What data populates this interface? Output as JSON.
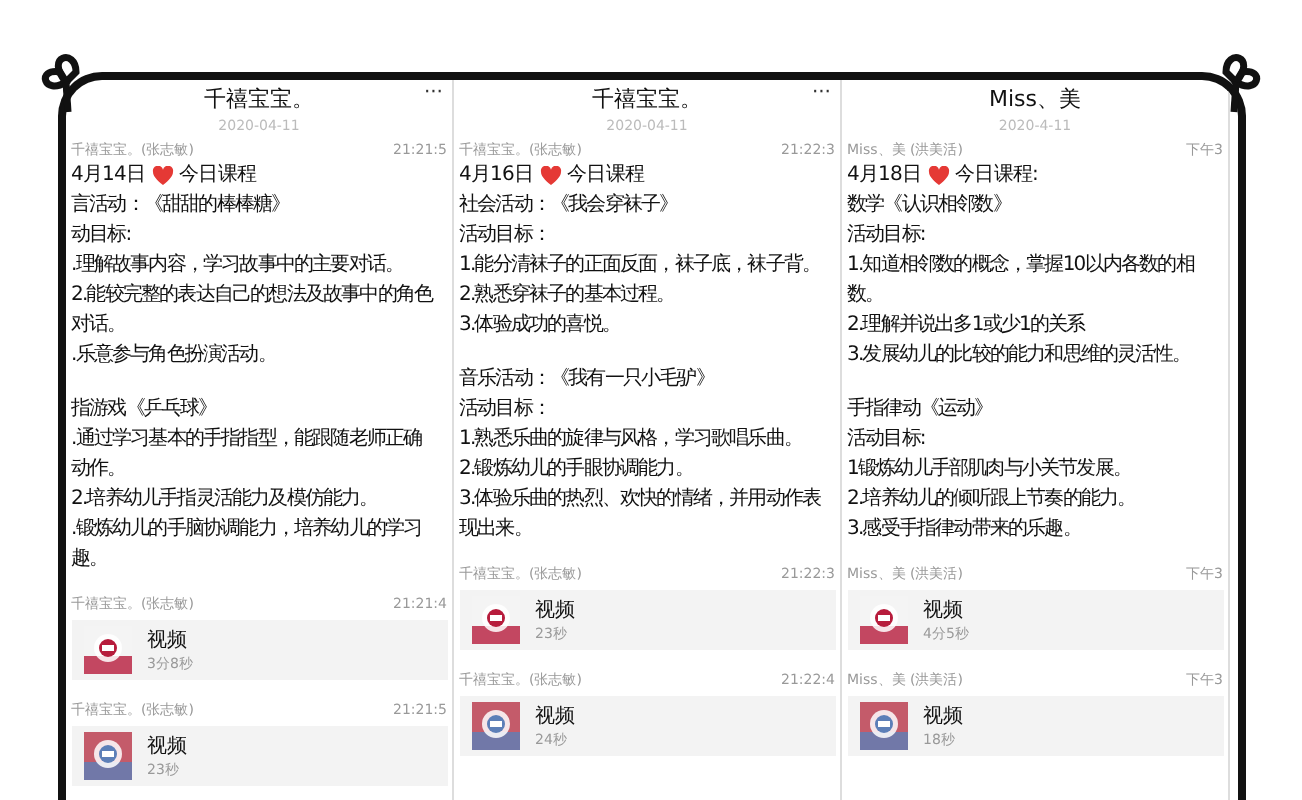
{
  "panels": [
    {
      "title": "千禧宝宝。",
      "menu": "···",
      "date": "2020-04-11",
      "messages": [
        {
          "kind": "text",
          "sender": "千禧宝宝。(张志敏)",
          "time": "21:21:5",
          "heading": {
            "day": "4月14日",
            "title": "今日课程"
          },
          "paragraphs": [
            [
              "言活动：《甜甜的棒棒糖》",
              "动目标:",
              ".理解故事内容，学习故事中的主要对话。",
              "2.能较完整的表达自己的想法及故事中的角色",
              "对话。",
              ".乐意参与角色扮演活动。"
            ],
            [
              "指游戏《乒乓球》",
              ".通过学习基本的手指指型，能跟随老师正确",
              "动作。",
              "2.培养幼儿手指灵活能力及模仿能力。",
              ".锻炼幼儿的手脑协调能力，培养幼儿的学习",
              "趣。"
            ]
          ]
        },
        {
          "kind": "video",
          "sender": "千禧宝宝。(张志敏)",
          "time": "21:21:4",
          "label": "视频",
          "duration": "3分8秒"
        },
        {
          "kind": "video",
          "sender": "千禧宝宝。(张志敏)",
          "time": "21:21:5",
          "label": "视频",
          "duration": "23秒"
        }
      ]
    },
    {
      "title": "千禧宝宝。",
      "menu": "···",
      "date": "2020-04-11",
      "messages": [
        {
          "kind": "text",
          "sender": "千禧宝宝。(张志敏)",
          "time": "21:22:3",
          "heading": {
            "day": "4月16日",
            "title": "今日课程"
          },
          "paragraphs": [
            [
              "社会活动：《我会穿袜子》",
              "活动目标：",
              "1.能分清袜子的正面反面，袜子底，袜子背。",
              "2.熟悉穿袜子的基本过程。",
              "3.体验成功的喜悦。"
            ],
            [
              "音乐活动：《我有一只小毛驴》",
              "活动目标：",
              "1.熟悉乐曲的旋律与风格，学习歌唱乐曲。",
              "2.锻炼幼儿的手眼协调能力。",
              "3.体验乐曲的热烈、欢快的情绪，并用动作表",
              "现出来。"
            ]
          ]
        },
        {
          "kind": "video",
          "sender": "千禧宝宝。(张志敏)",
          "time": "21:22:3",
          "label": "视频",
          "duration": "23秒"
        },
        {
          "kind": "video",
          "sender": "千禧宝宝。(张志敏)",
          "time": "21:22:4",
          "label": "视频",
          "duration": "24秒"
        }
      ]
    },
    {
      "title": "Miss、美",
      "date": "2020-4-11",
      "messages": [
        {
          "kind": "text",
          "sender": "Miss、美 (洪美活)",
          "time": "下午3",
          "heading": {
            "day": "4月18日",
            "title": "今日课程:"
          },
          "paragraphs": [
            [
              "数学《认识相邻数》",
              "活动目标:",
              "1.知道相邻数的概念，掌握10以内各数的相",
              "数。",
              "2.理解并说出多1或少1的关系",
              "3.发展幼儿的比较的能力和思维的灵活性。"
            ],
            [
              "手指律动《运动》",
              "活动目标:",
              "1锻炼幼儿手部肌肉与小关节发展。",
              "2.培养幼儿的倾听跟上节奏的能力。",
              "3.感受手指律动带来的乐趣。"
            ]
          ]
        },
        {
          "kind": "video",
          "sender": "Miss、美 (洪美活)",
          "time": "下午3",
          "label": "视频",
          "duration": "4分5秒"
        },
        {
          "kind": "video",
          "sender": "Miss、美 (洪美活)",
          "time": "下午3",
          "label": "视频",
          "duration": "18秒"
        }
      ]
    }
  ]
}
